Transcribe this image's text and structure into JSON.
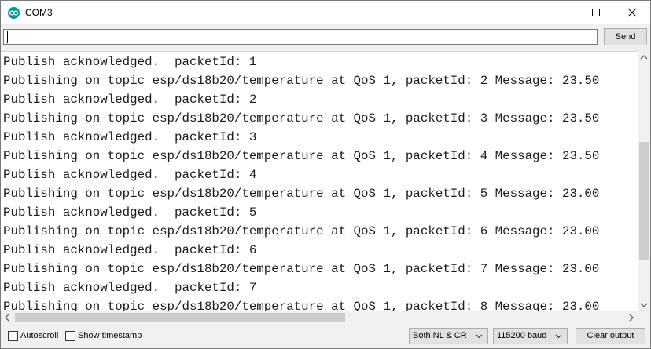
{
  "window": {
    "title": "COM3"
  },
  "input": {
    "value": "",
    "send_label": "Send"
  },
  "output": {
    "lines": [
      "Publish acknowledged.  packetId: 1",
      "Publishing on topic esp/ds18b20/temperature at QoS 1, packetId: 2 Message: 23.50",
      "Publish acknowledged.  packetId: 2",
      "Publishing on topic esp/ds18b20/temperature at QoS 1, packetId: 3 Message: 23.50",
      "Publish acknowledged.  packetId: 3",
      "Publishing on topic esp/ds18b20/temperature at QoS 1, packetId: 4 Message: 23.50",
      "Publish acknowledged.  packetId: 4",
      "Publishing on topic esp/ds18b20/temperature at QoS 1, packetId: 5 Message: 23.00",
      "Publish acknowledged.  packetId: 5",
      "Publishing on topic esp/ds18b20/temperature at QoS 1, packetId: 6 Message: 23.00",
      "Publish acknowledged.  packetId: 6",
      "Publishing on topic esp/ds18b20/temperature at QoS 1, packetId: 7 Message: 23.00",
      "Publish acknowledged.  packetId: 7",
      "Publishing on topic esp/ds18b20/temperature at QoS 1, packetId: 8 Message: 23.00"
    ]
  },
  "status": {
    "autoscroll_label": "Autoscroll",
    "autoscroll_checked": false,
    "timestamp_label": "Show timestamp",
    "timestamp_checked": false,
    "line_ending": "Both NL & CR",
    "baud": "115200 baud",
    "clear_label": "Clear output"
  },
  "colors": {
    "app_icon": "#00979c",
    "text": "#1a1a1a"
  }
}
